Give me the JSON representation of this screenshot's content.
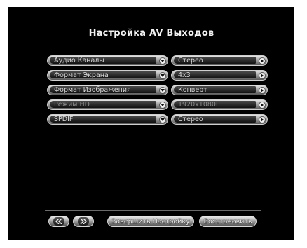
{
  "screen": {
    "title": "Настройка AV Выходов"
  },
  "settings": [
    {
      "name": "Аудио Каналы",
      "value": "Стерео",
      "enabled": true
    },
    {
      "name": "Формат Экрана",
      "value": "4x3",
      "enabled": true
    },
    {
      "name": "Формат Изображения",
      "value": "Конверт",
      "enabled": true
    },
    {
      "name": "Режим HD",
      "value": "1920x1080i",
      "enabled": false
    },
    {
      "name": "SPDIF",
      "value": "Стерео",
      "enabled": true
    }
  ],
  "footer": {
    "prev_icon": "double-chevron-left-icon",
    "next_icon": "double-chevron-right-icon",
    "finish_label": "Завершить Настройку",
    "restore_label": "Восстановить"
  }
}
